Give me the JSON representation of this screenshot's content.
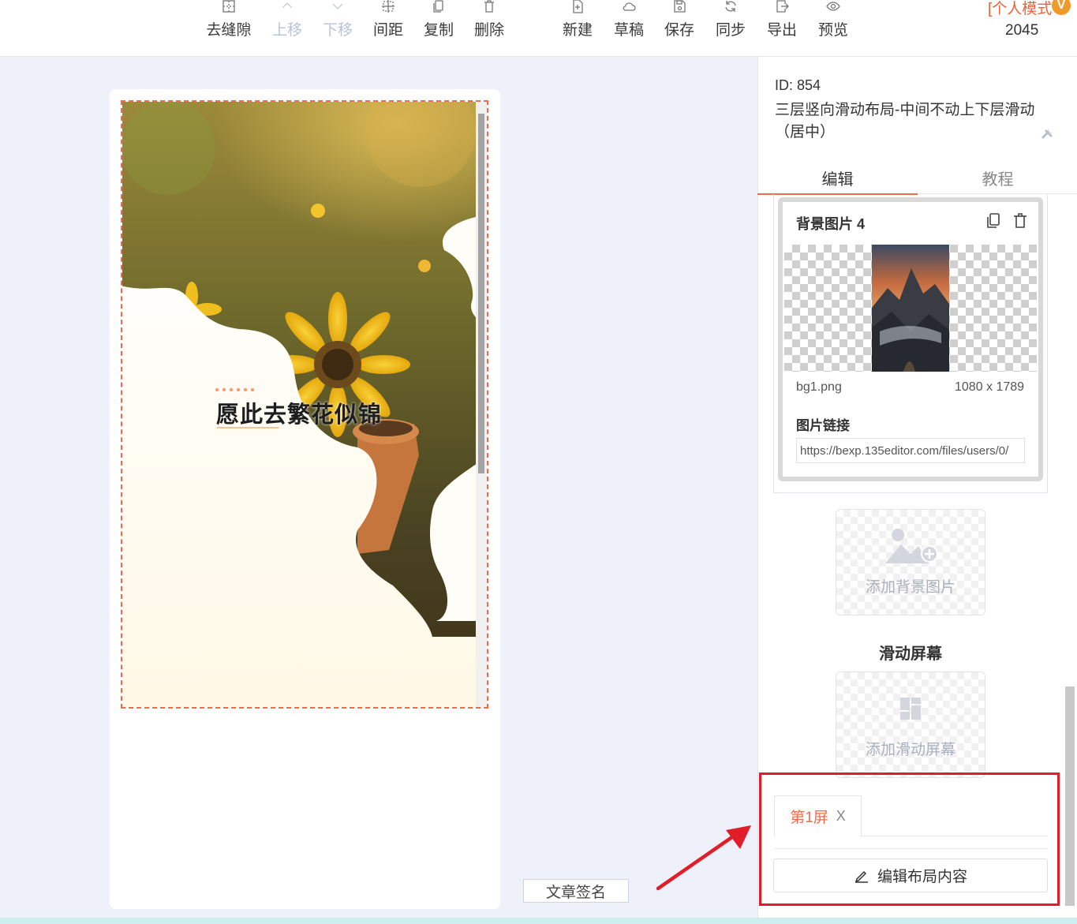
{
  "toolbar": {
    "buttons": [
      {
        "label": "去缝隙",
        "icon": "grid-gap-icon",
        "disabled": false
      },
      {
        "label": "上移",
        "icon": "chevron-up-icon",
        "disabled": true
      },
      {
        "label": "下移",
        "icon": "chevron-down-icon",
        "disabled": true
      },
      {
        "label": "间距",
        "icon": "spacing-icon",
        "disabled": false
      },
      {
        "label": "复制",
        "icon": "copy-icon",
        "disabled": false
      },
      {
        "label": "删除",
        "icon": "trash-icon",
        "disabled": false
      },
      {
        "label": "新建",
        "icon": "new-file-icon",
        "disabled": false
      },
      {
        "label": "草稿",
        "icon": "cloud-icon",
        "disabled": false
      },
      {
        "label": "保存",
        "icon": "save-icon",
        "disabled": false
      },
      {
        "label": "同步",
        "icon": "sync-icon",
        "disabled": false
      },
      {
        "label": "导出",
        "icon": "export-icon",
        "disabled": false
      },
      {
        "label": "预览",
        "icon": "eye-icon",
        "disabled": false
      }
    ],
    "mode_label": "[个人模式",
    "vip_badge": "V",
    "count": "2045"
  },
  "canvas": {
    "title_text": "愿此去繁花似锦",
    "signature_button": "文章签名"
  },
  "panel": {
    "template_id": "ID: 854",
    "template_name": "三层竖向滑动布局-中间不动上下层滑动（居中）",
    "tabs": {
      "edit": "编辑",
      "tutorial": "教程"
    },
    "bg_card": {
      "title": "背景图片 4",
      "file_name": "bg1.png",
      "file_size": "1080 x 1789",
      "link_label": "图片链接",
      "link_value": "https://bexp.135editor.com/files/users/0/"
    },
    "add_bg_label": "添加背景图片",
    "section_title": "滑动屏幕",
    "add_screen_label": "添加滑动屏幕",
    "screen_tab": {
      "name": "第1屏",
      "close": "X"
    },
    "edit_layout_label": "编辑布局内容"
  },
  "colors": {
    "accent": "#ef6b4f",
    "annotation": "#e11d2a",
    "vip": "#f19a2c"
  }
}
